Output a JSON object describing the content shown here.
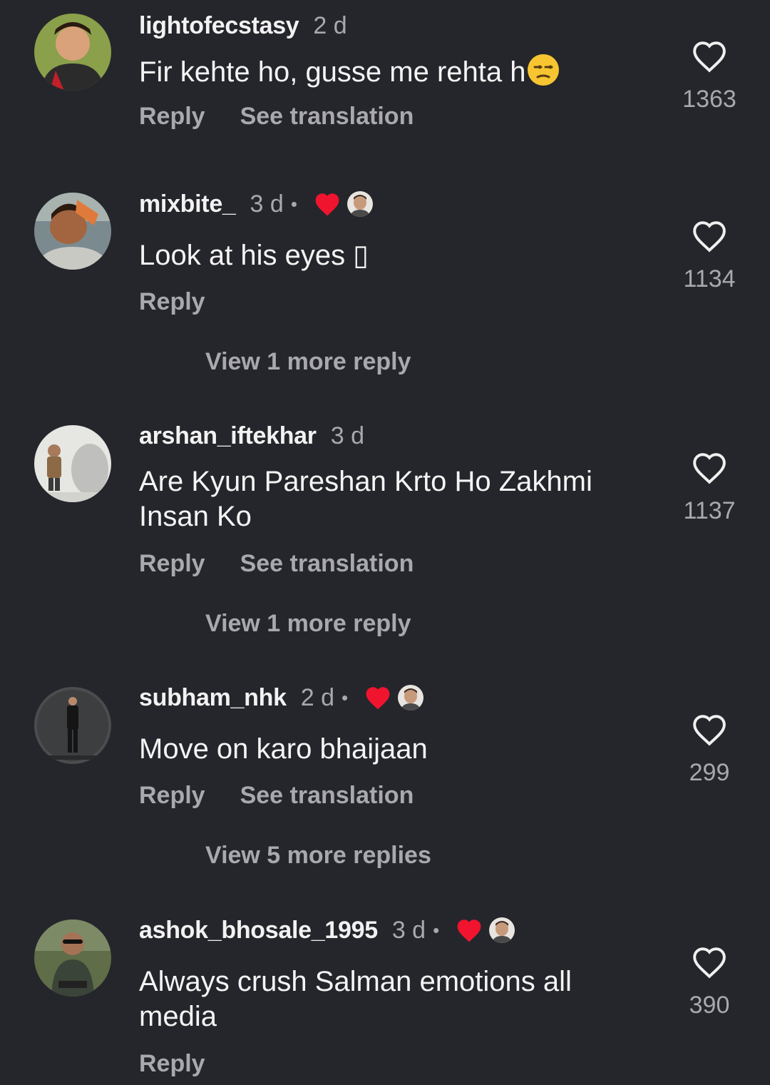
{
  "comments": [
    {
      "username": "lightofecstasy",
      "time": "2 d",
      "text": "Fir kehte ho, gusse me rehta h",
      "reply": "Reply",
      "see_translation": "See translation",
      "likes": "1363",
      "liked_by_creator": false,
      "text_emoji": "unamused-face-emoji"
    },
    {
      "username": "mixbite_",
      "time": "3 d",
      "dot": "•",
      "text": "Look at his eyes ▯",
      "reply": "Reply",
      "likes": "1134",
      "liked_by_creator": true,
      "view_replies": "View 1 more reply"
    },
    {
      "username": "arshan_iftekhar",
      "time": "3 d",
      "text": "Are Kyun Pareshan Krto Ho Zakhmi Insan Ko",
      "reply": "Reply",
      "see_translation": "See translation",
      "likes": "1137",
      "liked_by_creator": false,
      "view_replies": "View 1 more reply"
    },
    {
      "username": "subham_nhk",
      "time": "2 d",
      "dot": "•",
      "text": "Move on karo bhaijaan",
      "reply": "Reply",
      "see_translation": "See translation",
      "likes": "299",
      "liked_by_creator": true,
      "view_replies": "View 5 more replies"
    },
    {
      "username": "ashok_bhosale_1995",
      "time": "3 d",
      "dot": "•",
      "text": "Always crush Salman emotions all media",
      "reply": "Reply",
      "likes": "390",
      "liked_by_creator": true
    }
  ],
  "colors": {
    "background": "#25262b",
    "primary_text": "#f2f2f2",
    "secondary_text": "#a8a8ad",
    "heart_red": "#f0142f"
  },
  "icons": {
    "like": "heart-outline-icon",
    "creator_like": "red-heart-icon",
    "creator_avatar": "creator-avatar"
  }
}
